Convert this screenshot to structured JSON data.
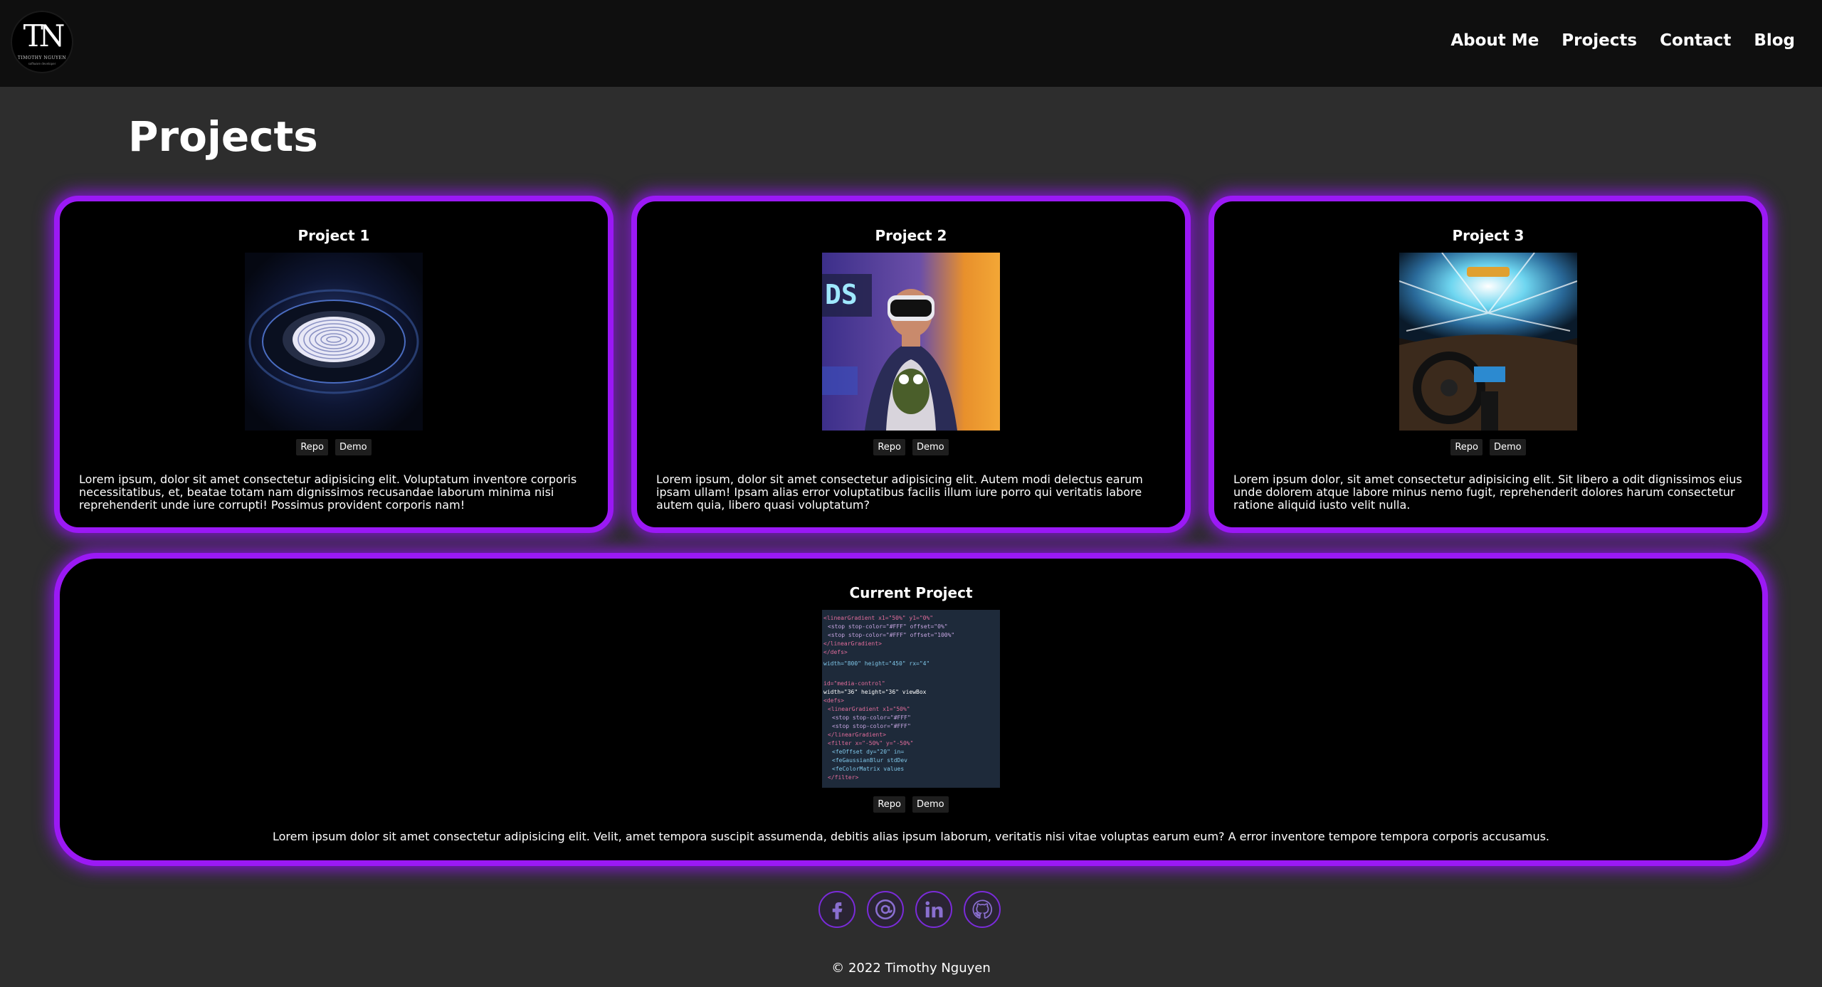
{
  "header": {
    "logo": {
      "mark": "TN",
      "name": "TIMOTHY NGUYEN",
      "sub": "software developer"
    },
    "nav": [
      {
        "label": "About Me"
      },
      {
        "label": "Projects"
      },
      {
        "label": "Contact"
      },
      {
        "label": "Blog"
      }
    ]
  },
  "page": {
    "title": "Projects"
  },
  "projects": [
    {
      "title": "Project 1",
      "image": "fingerprint-scanner-image",
      "repo_label": "Repo",
      "demo_label": "Demo",
      "description": "Lorem ipsum, dolor sit amet consectetur adipisicing elit. Voluptatum inventore corporis necessitatibus, et, beatae totam nam dignissimos recusandae laborum minima nisi reprehenderit unde iure corrupti! Possimus provident corporis nam!"
    },
    {
      "title": "Project 2",
      "image": "vr-headset-person-image",
      "repo_label": "Repo",
      "demo_label": "Demo",
      "description": "Lorem ipsum, dolor sit amet consectetur adipisicing elit. Autem modi delectus earum ipsam ullam! Ipsam alias error voluptatibus facilis illum iure porro qui veritatis labore autem quia, libero quasi voluptatum?"
    },
    {
      "title": "Project 3",
      "image": "car-interior-hyperspeed-image",
      "repo_label": "Repo",
      "demo_label": "Demo",
      "description": "Lorem ipsum dolor, sit amet consectetur adipisicing elit. Sit libero a odit dignissimos eius unde dolorem atque labore minus nemo fugit, reprehenderit dolores harum consectetur ratione aliquid iusto velit nulla."
    }
  ],
  "current_project": {
    "title": "Current Project",
    "image": "code-screen-image",
    "repo_label": "Repo",
    "demo_label": "Demo",
    "description": "Lorem ipsum dolor sit amet consectetur adipisicing elit. Velit, amet tempora suscipit assumenda, debitis alias ipsum laborum, veritatis nisi vitae voluptas earum eum? A error inventore tempore tempora corporis accusamus."
  },
  "socials": [
    {
      "icon": "facebook-icon"
    },
    {
      "icon": "email-at-icon"
    },
    {
      "icon": "linkedin-icon"
    },
    {
      "icon": "github-icon"
    }
  ],
  "footer": {
    "copyright": "© 2022 Timothy Nguyen"
  },
  "colors": {
    "background": "#2d2d2d",
    "header": "#0f0f0f",
    "card": "#000000",
    "accent_glow": "#9b19f5"
  }
}
